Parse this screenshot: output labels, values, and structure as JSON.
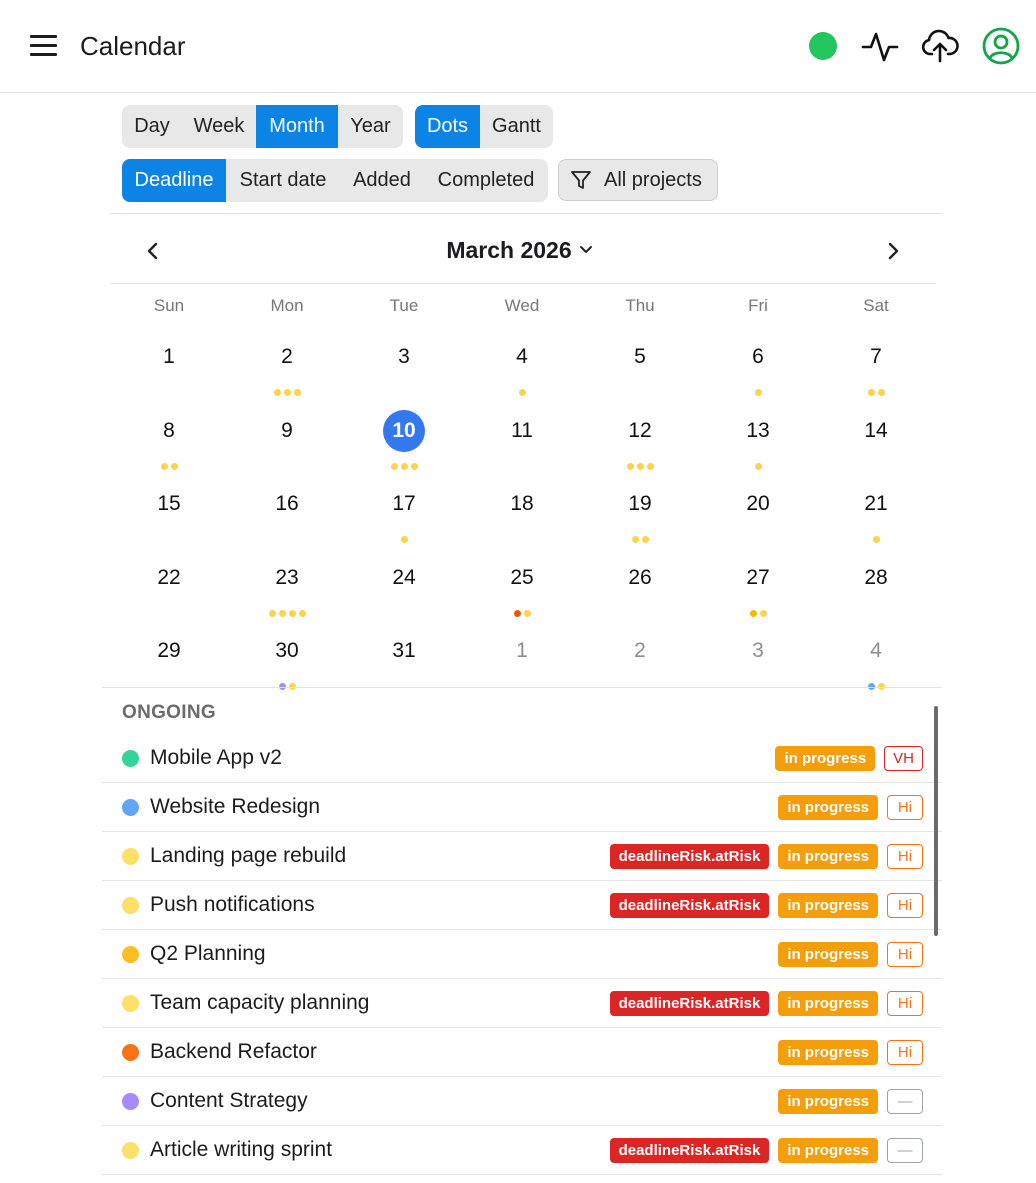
{
  "header": {
    "title": "Calendar",
    "status_color": "#22c55e",
    "icons": [
      "menu-icon",
      "activity-icon",
      "cloud-upload-icon",
      "account-icon"
    ]
  },
  "view_modes": {
    "options": [
      "Day",
      "Week",
      "Month",
      "Year"
    ],
    "selected": "Month"
  },
  "display_modes": {
    "options": [
      "Dots",
      "Gantt"
    ],
    "selected": "Dots"
  },
  "date_filters": {
    "options": [
      "Deadline",
      "Start date",
      "Added",
      "Completed"
    ],
    "selected": "Deadline"
  },
  "project_filter": {
    "label": "All projects",
    "icon": "filter-icon"
  },
  "calendar": {
    "month_label": "March 2026",
    "weekdays": [
      "Sun",
      "Mon",
      "Tue",
      "Wed",
      "Thu",
      "Fri",
      "Sat"
    ],
    "today": 10,
    "weeks": [
      [
        {
          "d": "1",
          "dots": []
        },
        {
          "d": "2",
          "dots": [
            "#fcd34d",
            "#fcd34d",
            "#fcd34d"
          ]
        },
        {
          "d": "3",
          "dots": []
        },
        {
          "d": "4",
          "dots": [
            "#fcd34d"
          ]
        },
        {
          "d": "5",
          "dots": []
        },
        {
          "d": "6",
          "dots": [
            "#fcd34d"
          ]
        },
        {
          "d": "7",
          "dots": [
            "#fcd34d",
            "#fcd34d"
          ]
        }
      ],
      [
        {
          "d": "8",
          "dots": [
            "#fcd34d",
            "#fcd34d"
          ]
        },
        {
          "d": "9",
          "dots": []
        },
        {
          "d": "10",
          "dots": [
            "#fcd34d",
            "#fcd34d",
            "#fcd34d"
          ],
          "today": true
        },
        {
          "d": "11",
          "dots": []
        },
        {
          "d": "12",
          "dots": [
            "#fcd34d",
            "#fcd34d",
            "#fcd34d"
          ]
        },
        {
          "d": "13",
          "dots": [
            "#fcd34d"
          ]
        },
        {
          "d": "14",
          "dots": []
        }
      ],
      [
        {
          "d": "15",
          "dots": []
        },
        {
          "d": "16",
          "dots": []
        },
        {
          "d": "17",
          "dots": [
            "#fcd34d"
          ]
        },
        {
          "d": "18",
          "dots": []
        },
        {
          "d": "19",
          "dots": [
            "#fcd34d",
            "#fcd34d"
          ]
        },
        {
          "d": "20",
          "dots": []
        },
        {
          "d": "21",
          "dots": [
            "#fcd34d"
          ]
        }
      ],
      [
        {
          "d": "22",
          "dots": []
        },
        {
          "d": "23",
          "dots": [
            "#fcd34d",
            "#fcd34d",
            "#fcd34d",
            "#fcd34d"
          ]
        },
        {
          "d": "24",
          "dots": []
        },
        {
          "d": "25",
          "dots": [
            "#ea580c",
            "#fcd34d"
          ]
        },
        {
          "d": "26",
          "dots": []
        },
        {
          "d": "27",
          "dots": [
            "#f5b800",
            "#fcd34d"
          ]
        },
        {
          "d": "28",
          "dots": []
        }
      ],
      [
        {
          "d": "29",
          "dots": []
        },
        {
          "d": "30",
          "dots": [
            "#a78bfa",
            "#fcd34d"
          ]
        },
        {
          "d": "31",
          "dots": []
        },
        {
          "d": "1",
          "dots": [],
          "muted": true
        },
        {
          "d": "2",
          "dots": [],
          "muted": true
        },
        {
          "d": "3",
          "dots": [],
          "muted": true
        },
        {
          "d": "4",
          "dots": [
            "#60a5fa",
            "#fcd34d"
          ],
          "muted": true
        }
      ]
    ]
  },
  "ongoing": {
    "label": "ONGOING",
    "tasks": [
      {
        "name": "Mobile App v2",
        "color": "#34d399",
        "risk": "",
        "status": "in progress",
        "priority": "VH",
        "priority_kind": "vh"
      },
      {
        "name": "Website Redesign",
        "color": "#60a5fa",
        "risk": "",
        "status": "in progress",
        "priority": "Hi",
        "priority_kind": "hi"
      },
      {
        "name": "Landing page rebuild",
        "color": "#fde068",
        "risk": "deadlineRisk.atRisk",
        "status": "in progress",
        "priority": "Hi",
        "priority_kind": "hi"
      },
      {
        "name": "Push notifications",
        "color": "#fde068",
        "risk": "deadlineRisk.atRisk",
        "status": "in progress",
        "priority": "Hi",
        "priority_kind": "hi"
      },
      {
        "name": "Q2 Planning",
        "color": "#fbbf24",
        "risk": "",
        "status": "in progress",
        "priority": "Hi",
        "priority_kind": "hi"
      },
      {
        "name": "Team capacity planning",
        "color": "#fde068",
        "risk": "deadlineRisk.atRisk",
        "status": "in progress",
        "priority": "Hi",
        "priority_kind": "hi"
      },
      {
        "name": "Backend Refactor",
        "color": "#f97316",
        "risk": "",
        "status": "in progress",
        "priority": "Hi",
        "priority_kind": "hi"
      },
      {
        "name": "Content Strategy",
        "color": "#a78bfa",
        "risk": "",
        "status": "in progress",
        "priority": "—",
        "priority_kind": "none"
      },
      {
        "name": "Article writing sprint",
        "color": "#fde068",
        "risk": "deadlineRisk.atRisk",
        "status": "in progress",
        "priority": "—",
        "priority_kind": "none"
      }
    ]
  }
}
